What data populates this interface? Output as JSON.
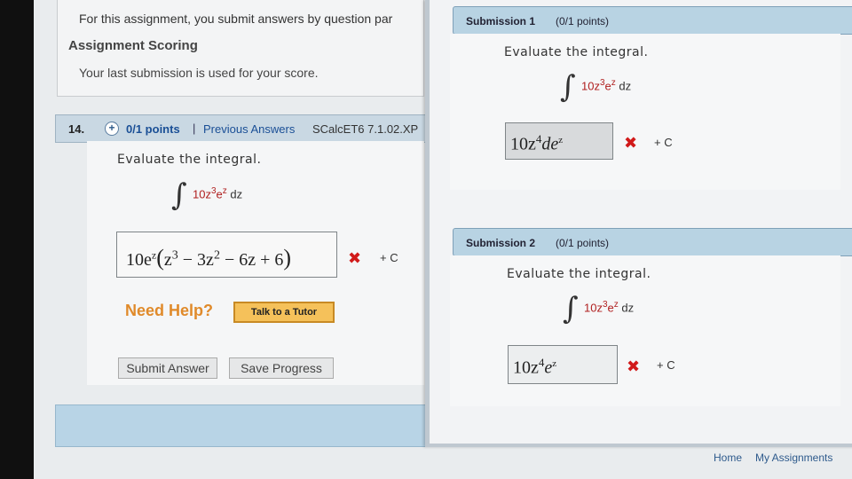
{
  "intro": {
    "text": "For this assignment, you submit answers by question par",
    "scoring_title": "Assignment Scoring",
    "scoring_text": "Your last submission is used for your score."
  },
  "question": {
    "number": "14.",
    "plus": "+",
    "points": "0/1 points",
    "separator": "|",
    "previous_answers": "Previous Answers",
    "code": "SCalcET6 7.1.02.XP",
    "prompt": "Evaluate the integral.",
    "integral": {
      "coef": "10z",
      "exp1": "3",
      "base": "e",
      "exp2": "z",
      "dz": "dz"
    },
    "answer": "10e^z(z^3 − 3z^2 − 6z + 6)",
    "answer_parts": {
      "lead": "10e",
      "lead_sup": "z",
      "open": "(",
      "t1": "z",
      "t1_sup": "3",
      "t2": " − 3z",
      "t2_sup": "2",
      "rest": " − 6z + 6",
      "close": ")"
    },
    "wrong_mark": "✖",
    "plus_c": "+ C"
  },
  "help": {
    "need_help": "Need Help?",
    "tutor_button": "Talk to a Tutor"
  },
  "buttons": {
    "submit": "Submit Answer",
    "save": "Save Progress"
  },
  "footer": {
    "home": "Home",
    "my_assignments": "My Assignments"
  },
  "submissions": [
    {
      "title": "Submission 1",
      "points": "(0/1 points)",
      "prompt": "Evaluate the integral.",
      "integral": {
        "coef": "10z",
        "exp1": "3",
        "base": "e",
        "exp2": "z",
        "dz": "dz"
      },
      "answer_main": "10z",
      "answer_sup": "4",
      "answer_tail": "de",
      "answer_tail_sup": "z",
      "wrong_mark": "✖",
      "plus_c": "+ C"
    },
    {
      "title": "Submission 2",
      "points": "(0/1 points)",
      "prompt": "Evaluate the integral.",
      "integral": {
        "coef": "10z",
        "exp1": "3",
        "base": "e",
        "exp2": "z",
        "dz": "dz"
      },
      "answer_main": "10z",
      "answer_sup": "4",
      "answer_tail": "e",
      "answer_tail_sup": "z",
      "wrong_mark": "✖",
      "plus_c": "+ C"
    }
  ],
  "colors": {
    "link": "#1a4f96",
    "wrong": "#d11a1a",
    "help": "#e08a2a",
    "header_blue": "#b8d3e3"
  }
}
